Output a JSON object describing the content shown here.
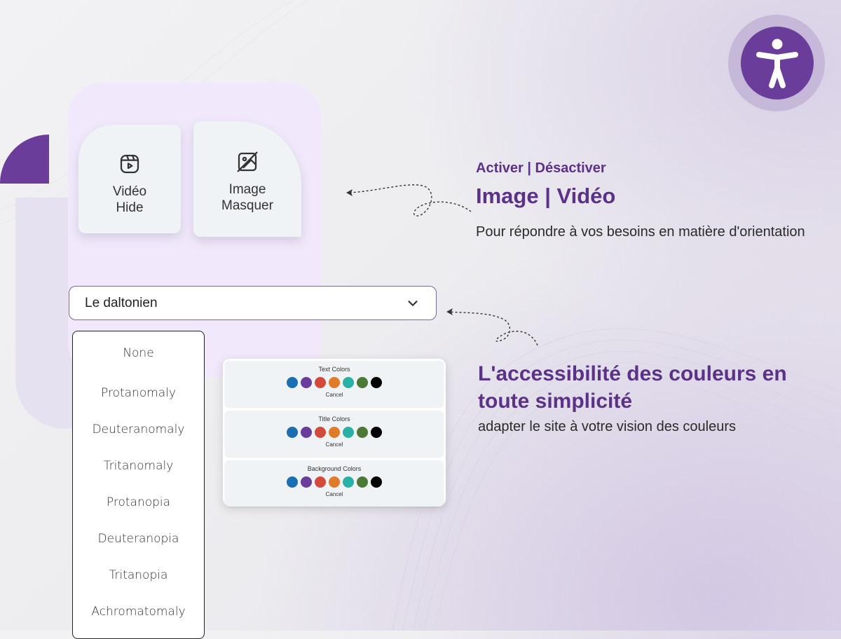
{
  "cards": {
    "video": {
      "label": "Vidéo\nHide",
      "icon": "video-reel-icon"
    },
    "image": {
      "label": "Image\nMasquer",
      "icon": "image-off-icon"
    }
  },
  "select": {
    "value": "Le daltonien",
    "icon": "chevron-down-icon"
  },
  "menu": {
    "items": [
      "None",
      "Protanomaly",
      "Deuteranomaly",
      "Tritanomaly",
      "Protanopia",
      "Deuteranopia",
      "Tritanopia",
      "Achromatomaly"
    ]
  },
  "color_panel": {
    "groups": [
      {
        "title": "Text Colors",
        "cancel": "Cancel"
      },
      {
        "title": "Title Colors",
        "cancel": "Cancel"
      },
      {
        "title": "Background Colors",
        "cancel": "Cancel"
      }
    ],
    "swatches": [
      "#1a6fb3",
      "#6a3d9a",
      "#d24a3a",
      "#e07b2a",
      "#2bb0a6",
      "#4a7a35",
      "#000000"
    ]
  },
  "section1": {
    "subtitle": "Activer | Désactiver",
    "title": "Image | Vidéo",
    "description": "Pour répondre à vos besoins en matière d'orientation"
  },
  "section2": {
    "title": "L'accessibilité des couleurs en toute simplicité",
    "description": "adapter le site à votre vision des couleurs"
  },
  "accessibility_button": {
    "icon": "accessibility-person-icon"
  },
  "colors": {
    "accent": "#5b3288",
    "brand": "#6a3d9a",
    "panel": "#f1e9fb"
  }
}
